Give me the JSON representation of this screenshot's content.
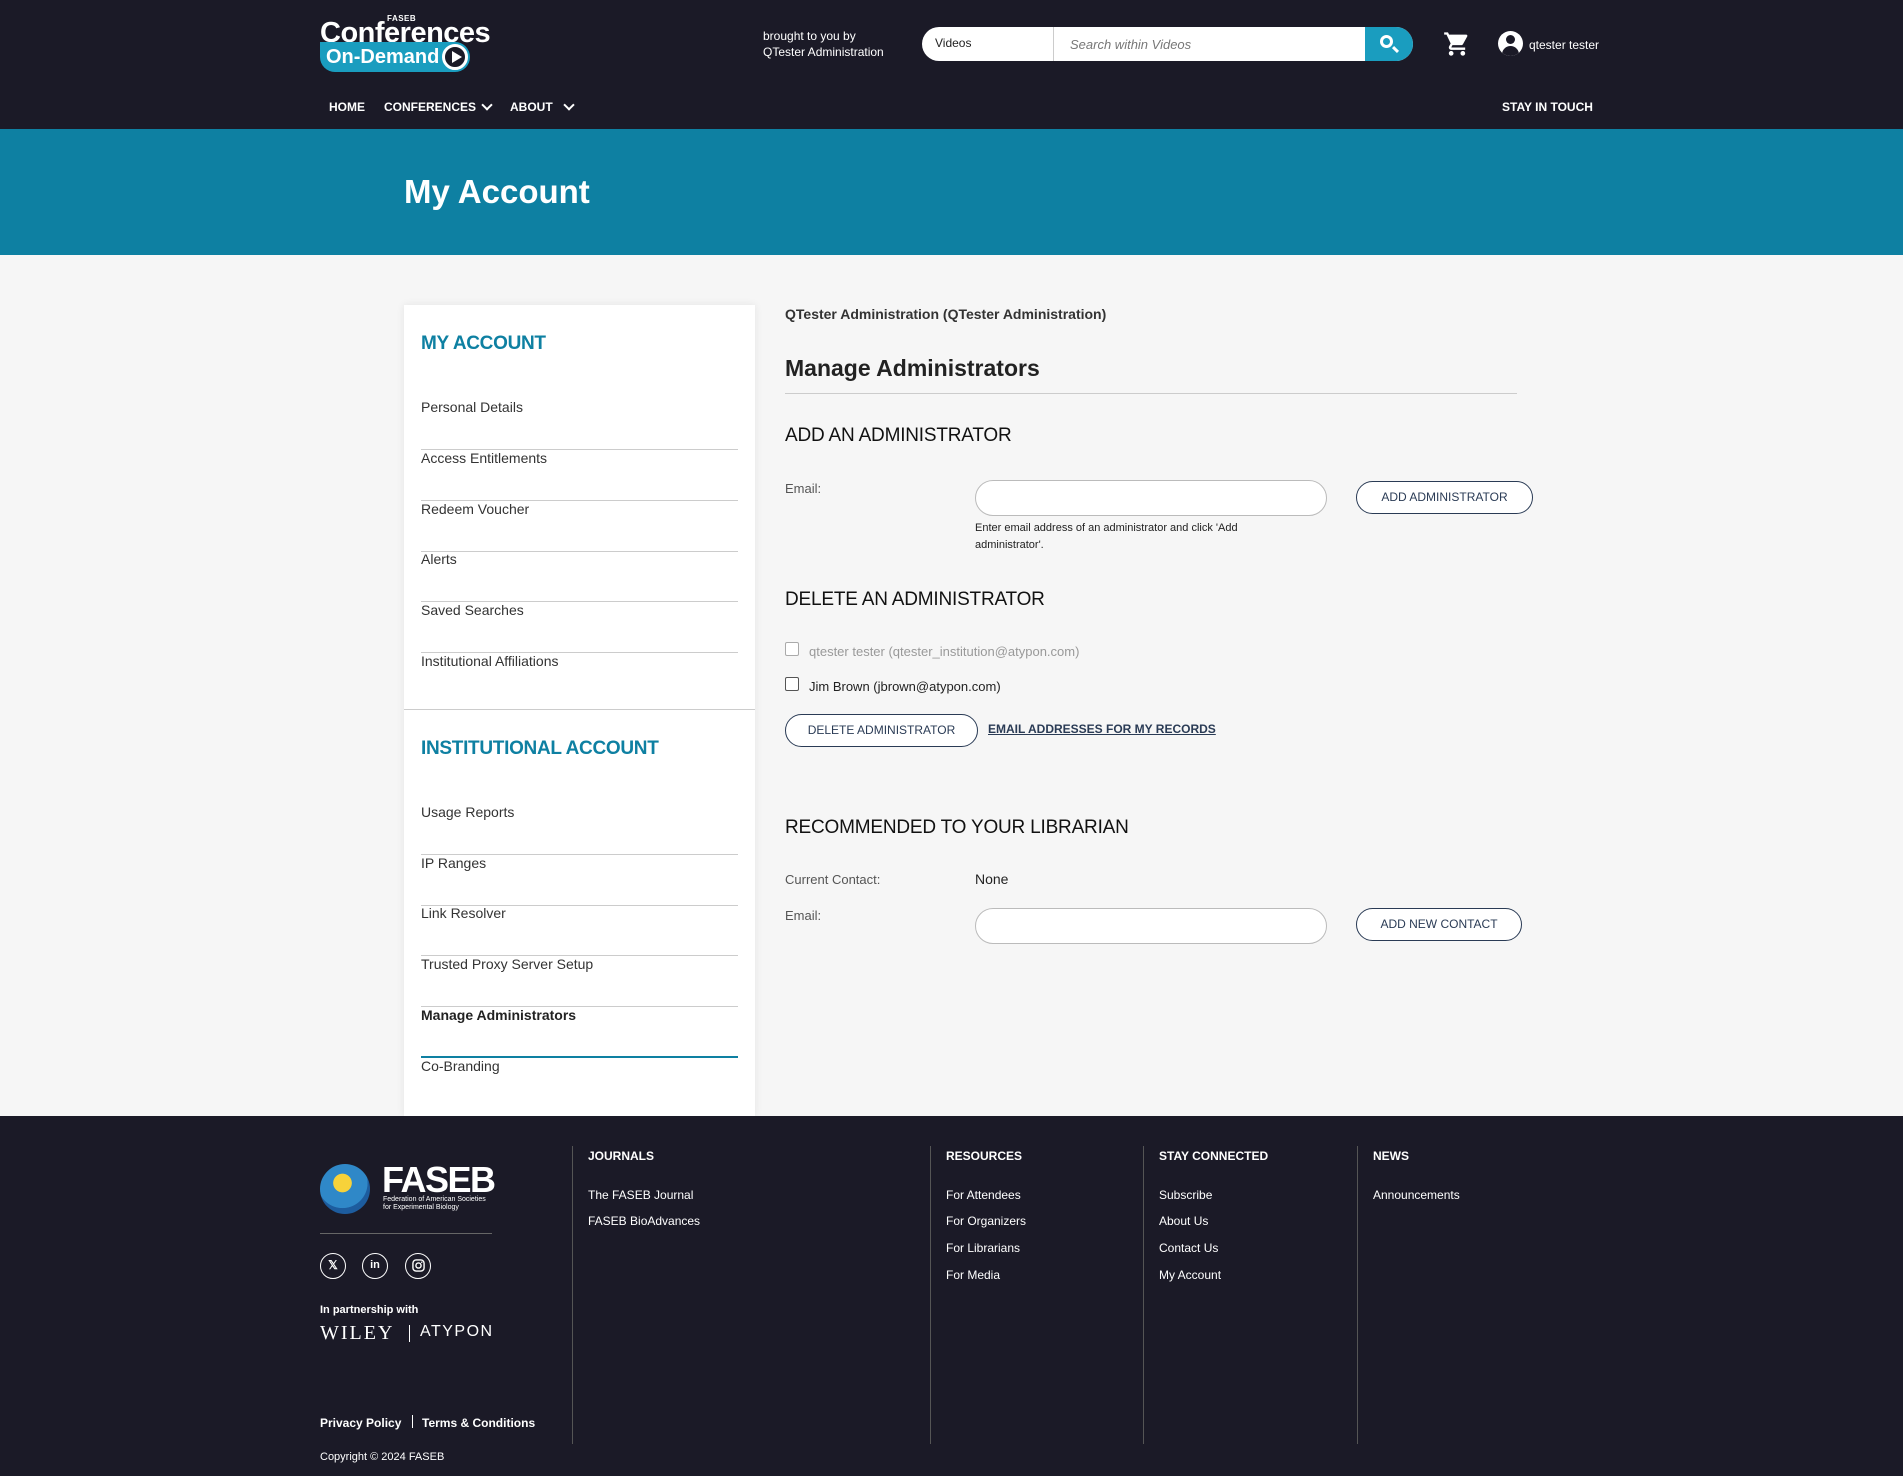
{
  "header": {
    "logo": {
      "small": "FASEB",
      "main": "Conferences",
      "sub": "On-Demand"
    },
    "brought_line1": "brought to you by",
    "brought_line2": "QTester Administration",
    "search": {
      "scope": "Videos",
      "placeholder": "Search within Videos"
    },
    "username": "qtester tester",
    "nav": {
      "home": "HOME",
      "conferences": "CONFERENCES",
      "about": "ABOUT",
      "stay": "STAY IN TOUCH"
    }
  },
  "banner": {
    "title": "My Account"
  },
  "sidebar": {
    "my_account_heading": "MY ACCOUNT",
    "my_account_items": [
      "Personal Details",
      "Access Entitlements",
      "Redeem Voucher",
      "Alerts",
      "Saved Searches",
      "Institutional Affiliations"
    ],
    "institutional_heading": "INSTITUTIONAL ACCOUNT",
    "institutional_items": [
      "Usage Reports",
      "IP Ranges",
      "Link Resolver",
      "Trusted Proxy Server Setup",
      "Manage Administrators",
      "Co-Branding"
    ]
  },
  "main": {
    "org": "QTester Administration (QTester Administration)",
    "title": "Manage Administrators",
    "add": {
      "heading": "ADD AN ADMINISTRATOR",
      "email_label": "Email:",
      "email_value": "",
      "button": "ADD ADMINISTRATOR",
      "hint": "Enter email address of an administrator and click 'Add administrator'."
    },
    "delete": {
      "heading": "DELETE AN ADMINISTRATOR",
      "admins": [
        {
          "label": "qtester tester (qtester_institution@atypon.com)",
          "disabled": true,
          "checked": false
        },
        {
          "label": "Jim Brown (jbrown@atypon.com)",
          "disabled": false,
          "checked": false
        }
      ],
      "button": "DELETE ADMINISTRATOR",
      "link": "EMAIL ADDRESSES FOR MY RECORDS"
    },
    "librarian": {
      "heading": "RECOMMENDED TO YOUR LIBRARIAN",
      "contact_label": "Current Contact:",
      "contact_value": "None",
      "email_label": "Email:",
      "email_value": "",
      "button": "ADD NEW CONTACT"
    }
  },
  "footer": {
    "faseb_name": "FASEB",
    "faseb_full": "Federation of American Societies for Experimental Biology",
    "social": [
      "x-icon",
      "linkedin-icon",
      "instagram-icon"
    ],
    "partnership": "In partnership with",
    "wiley": "WILEY",
    "atypon": "ATYPON",
    "journals": {
      "heading": "JOURNALS",
      "links": [
        "The FASEB Journal",
        "FASEB BioAdvances"
      ]
    },
    "resources": {
      "heading": "RESOURCES",
      "links": [
        "For Attendees",
        "For Organizers",
        "For Librarians",
        "For Media"
      ]
    },
    "stay_connected": {
      "heading": "STAY CONNECTED",
      "links": [
        "Subscribe",
        "About Us",
        "Contact Us",
        "My Account"
      ]
    },
    "news": {
      "heading": "NEWS",
      "links": [
        "Announcements"
      ]
    },
    "privacy": "Privacy Policy",
    "terms": "Terms & Conditions",
    "copyright": "Copyright © 2024 FASEB"
  },
  "colors": {
    "header_bg": "#1b1a27",
    "banner_bg": "#0e80a2",
    "accent": "#1a9dbf",
    "button_border": "#2a3b55"
  }
}
